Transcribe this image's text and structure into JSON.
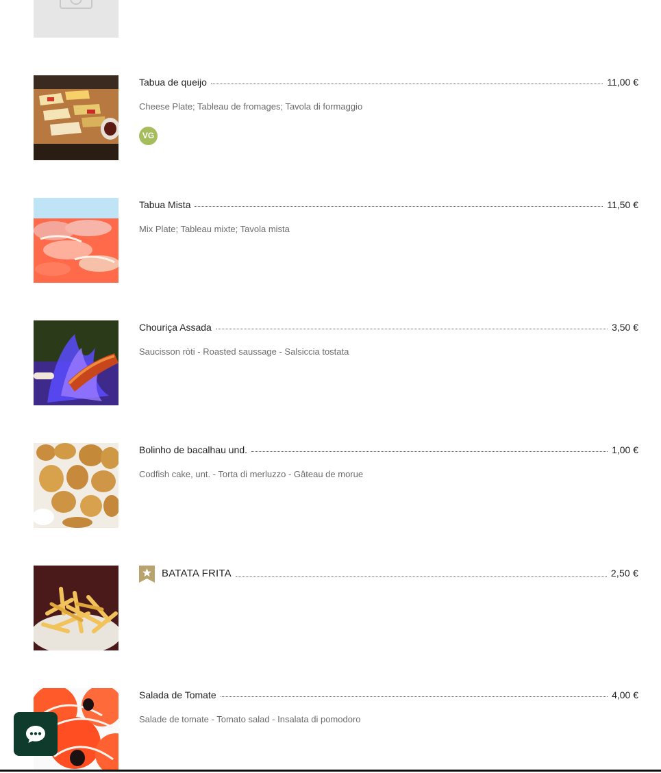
{
  "menu": {
    "items": [
      {
        "name": "Tabua de queijo",
        "price": "11,00 €",
        "description": "Cheese Plate; Tableau de fromages; Tavola di formaggio",
        "badge": "VG"
      },
      {
        "name": "Tabua Mista",
        "price": "11,50 €",
        "description": "Mix Plate; Tableau mixte; Tavola mista"
      },
      {
        "name": "Chouriça Assada",
        "price": "3,50 €",
        "description": "Saucisson ròti - Roasted saussage - Salsiccia tostata"
      },
      {
        "name": "Bolinho de bacalhau und.",
        "price": "1,00 €",
        "description": "Codfish cake, unt. - Torta di merluzzo - Gâteau de morue"
      },
      {
        "name": "BATATA FRITA",
        "price": "2,50 €",
        "featured": true
      },
      {
        "name": "Salada de Tomate",
        "price": "4,00 €",
        "description": "Salade de tomate - Tomato salad - Insalata di pomodoro"
      }
    ]
  },
  "colors": {
    "vg_badge": "#a6bd5e",
    "featured_badge": "#b8a26e",
    "chat_button": "#0e3b2c"
  },
  "icons": {
    "placeholder": "camera-icon",
    "featured": "star-ribbon-icon",
    "chat": "chat-bubble-icon"
  }
}
